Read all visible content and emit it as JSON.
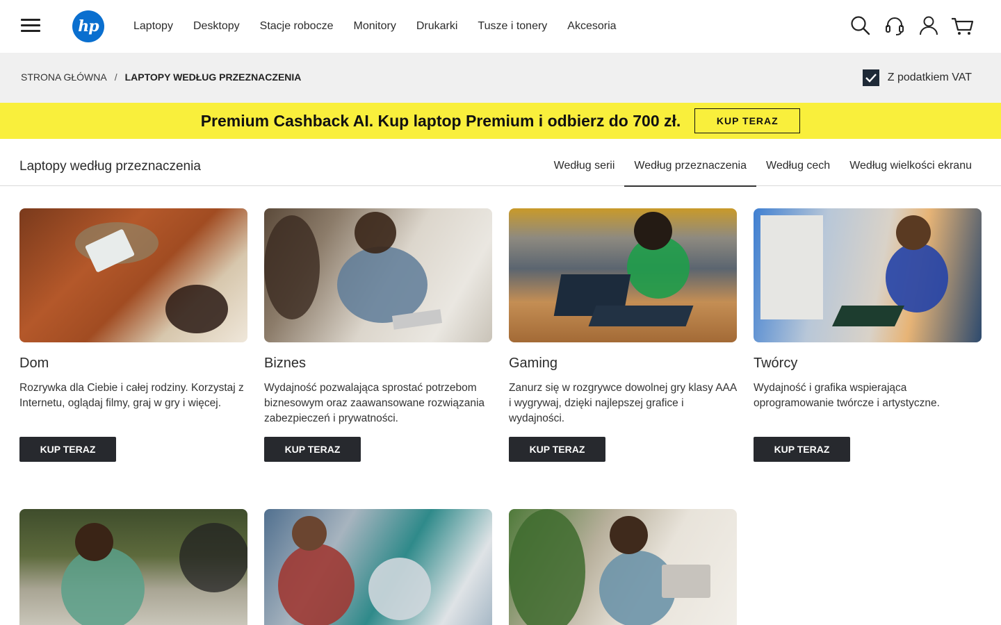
{
  "header": {
    "logo_text": "hp",
    "nav": [
      "Laptopy",
      "Desktopy",
      "Stacje robocze",
      "Monitory",
      "Drukarki",
      "Tusze i tonery",
      "Akcesoria"
    ],
    "icons": [
      "search-icon",
      "support-headset-icon",
      "account-icon",
      "cart-icon"
    ]
  },
  "breadcrumb": {
    "home": "STRONA GŁÓWNA",
    "separator": "/",
    "current": "LAPTOPY WEDŁUG PRZEZNACZENIA"
  },
  "vat": {
    "label": "Z podatkiem VAT",
    "checked": true
  },
  "promo": {
    "text": "Premium Cashback AI. Kup laptop Premium i odbierz do 700 zł.",
    "button": "KUP TERAZ",
    "background": "#f9ef3c"
  },
  "section": {
    "title": "Laptopy według przeznaczenia",
    "tabs": [
      {
        "label": "Według serii",
        "active": false
      },
      {
        "label": "Według przeznaczenia",
        "active": true
      },
      {
        "label": "Według cech",
        "active": false
      },
      {
        "label": "Według wielkości ekranu",
        "active": false
      }
    ]
  },
  "cards": [
    {
      "title": "Dom",
      "description": "Rozrywka dla Ciebie i całej rodziny. Korzystaj z Internetu, oglądaj filmy, graj w gry i więcej.",
      "button": "KUP TERAZ"
    },
    {
      "title": "Biznes",
      "description": "Wydajność pozwalająca sprostać potrzebom biznesowym oraz zaawansowane rozwiązania zabezpieczeń i prywatności.",
      "button": "KUP TERAZ"
    },
    {
      "title": "Gaming",
      "description": "Zanurz się w rozgrywce dowolnej gry klasy AAA i wygrywaj, dzięki najlepszej grafice i wydajności.",
      "button": "KUP TERAZ"
    },
    {
      "title": "Twórcy",
      "description": "Wydajność i grafika wspierająca oprogramowanie twórcze i artystyczne.",
      "button": "KUP TERAZ"
    }
  ],
  "colors": {
    "button_dark": "#27292e",
    "logo_blue": "#0a6fcf",
    "crumb_bg": "#f0f0f0"
  }
}
